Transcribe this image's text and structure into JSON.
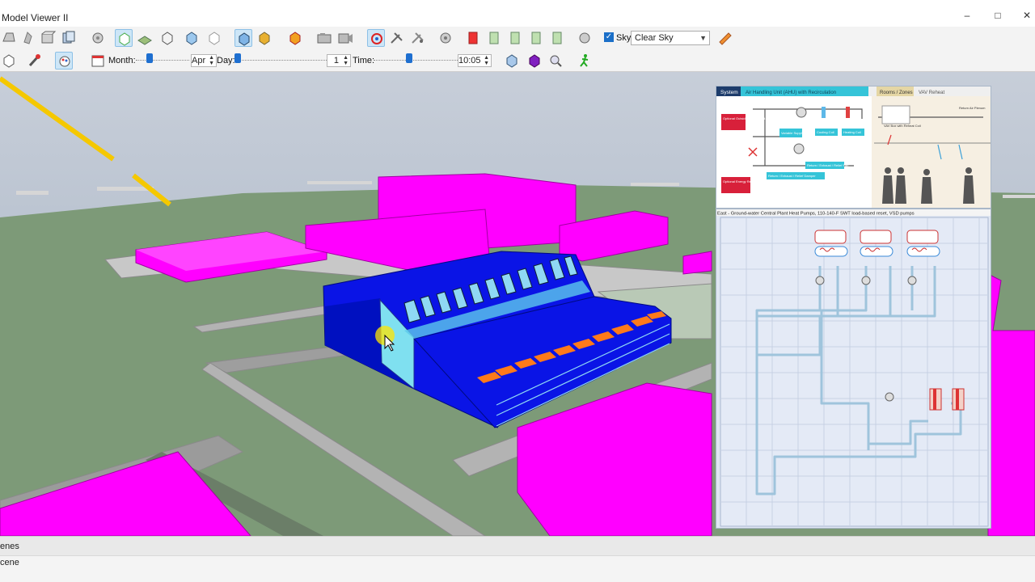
{
  "window": {
    "title": "Model Viewer II",
    "minimize": "–",
    "maximize": "□",
    "close": "✕"
  },
  "toolbar1": {
    "sky_label": "Sky",
    "sky_checked": true,
    "sky_option": "Clear Sky"
  },
  "toolbar2": {
    "month_label": "Month:",
    "month_value": "Apr",
    "day_label": "Day:",
    "day_value": "1",
    "time_label": "Time:",
    "time_value": "10:05",
    "month_fraction": 0.25,
    "day_fraction": 0.0,
    "time_fraction": 0.42
  },
  "ahu_diagram": {
    "tab_system": "System",
    "tab_system_name": "Air Handling Unit (AHU) with Recirculation",
    "tab_rooms": "Rooms / Zones",
    "tab_rooms_name": "VAV Reheat",
    "labels": {
      "outside_air": "Optional Outside Air Economizer",
      "heat_exchanger": "Optional Energy Recovery Heat Exchanger",
      "supply_fan": "Variable Supply Fan",
      "cooling_coil": "Cooling Coil",
      "heating_coil": "Heating Coil",
      "return_fan": "Return / Exhaust / Relief Fan",
      "return_damper": "Return / Exhaust / Relief Damper",
      "vav_box": "VAV Box with Reheat Coil",
      "return_plenum": "Return Air Plenum"
    }
  },
  "plant_diagram": {
    "title": "East - Ground-water Central Plant Heat Pumps, 110-140-F SWT load-based reset, VSD pumps"
  },
  "bottom_panel": {
    "section": "enes",
    "item": "cene"
  },
  "colors": {
    "building_blue": "#0a14e6",
    "context_magenta": "#ff00ff",
    "ground": "#7d9a78",
    "sky": "#a8b4c4",
    "shading_orange": "#ff7a1a",
    "sun_path": "#f5c800"
  }
}
